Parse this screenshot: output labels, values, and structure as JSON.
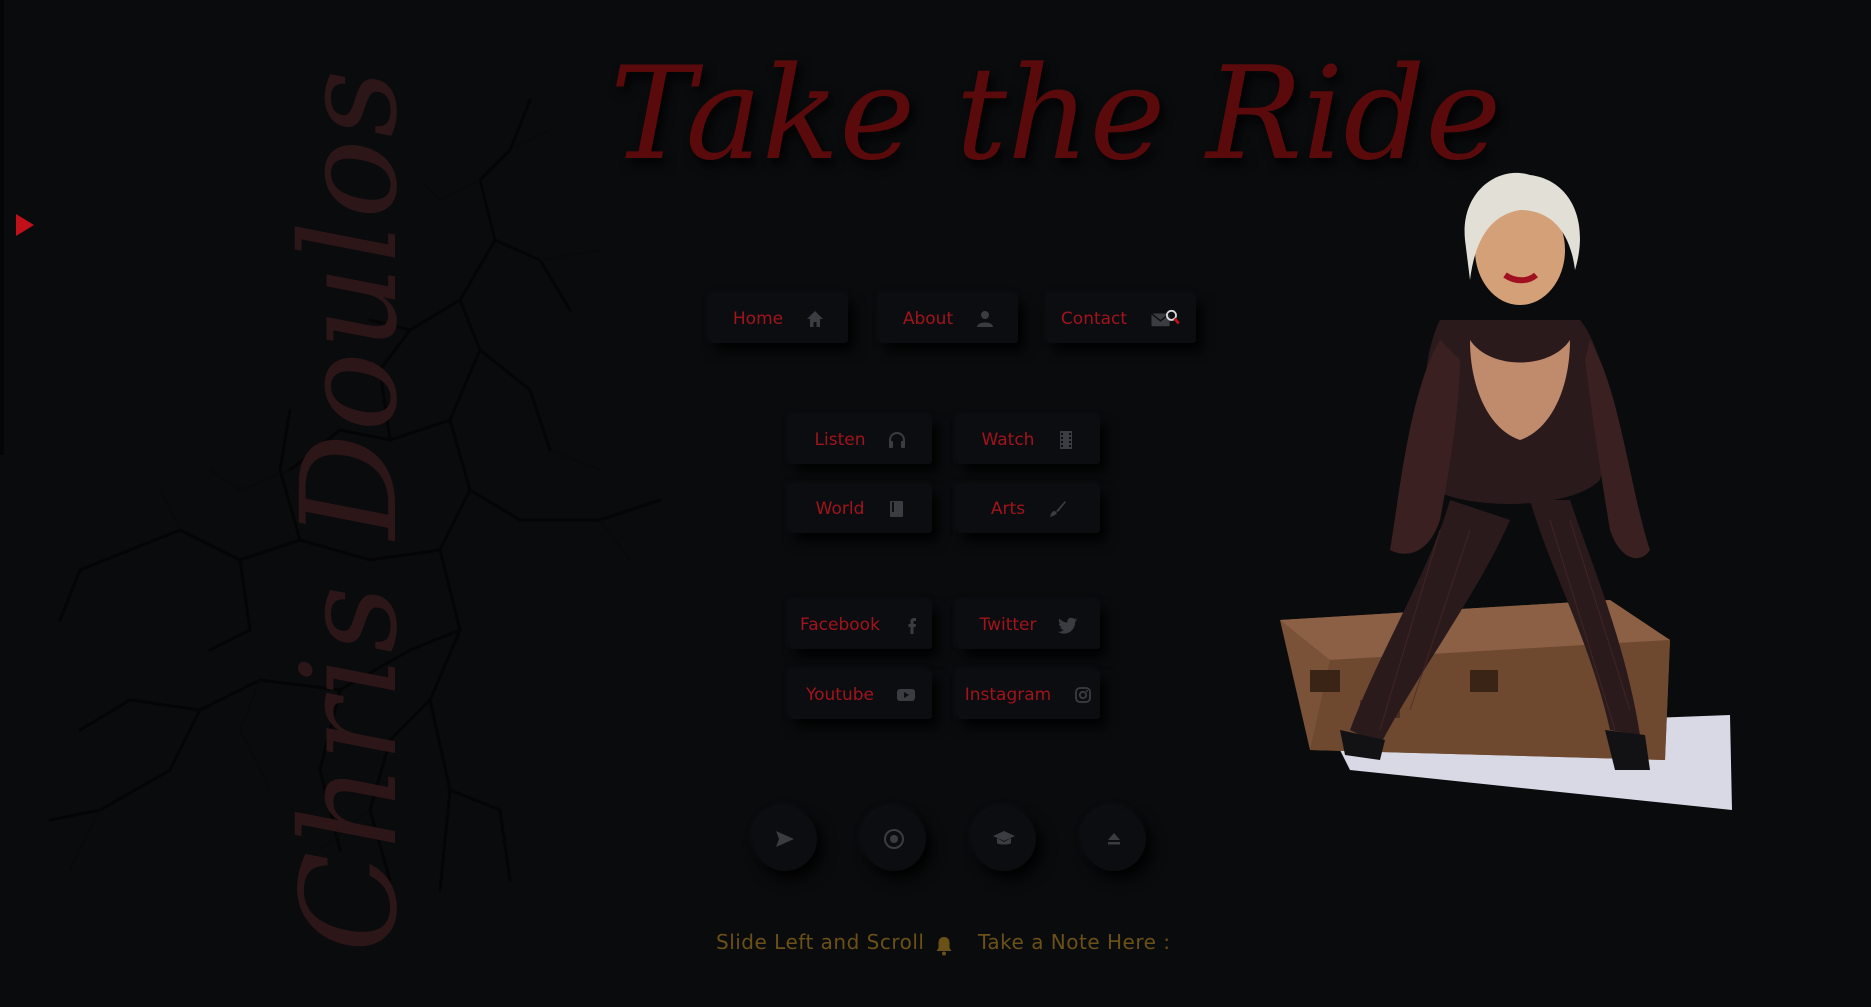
{
  "header": {
    "title": "Take the Ride",
    "side_name": "Chris Doulos"
  },
  "nav": {
    "home": "Home",
    "about": "About",
    "contact": "Contact"
  },
  "media": {
    "listen": "Listen",
    "watch": "Watch",
    "world": "World",
    "arts": "Arts"
  },
  "social": {
    "facebook": "Facebook",
    "twitter": "Twitter",
    "youtube": "Youtube",
    "instagram": "Instagram"
  },
  "round_buttons": [
    "send-icon",
    "record-icon",
    "graduation-cap-icon",
    "eject-icon"
  ],
  "footer": {
    "slide_hint": "Slide Left and Scroll",
    "note_label": "Take a Note Here :"
  },
  "colors": {
    "background": "#0a0b0d",
    "accent_red": "#a0141c",
    "title_red": "#5b0a0c",
    "footer_gold": "#6b5018"
  }
}
